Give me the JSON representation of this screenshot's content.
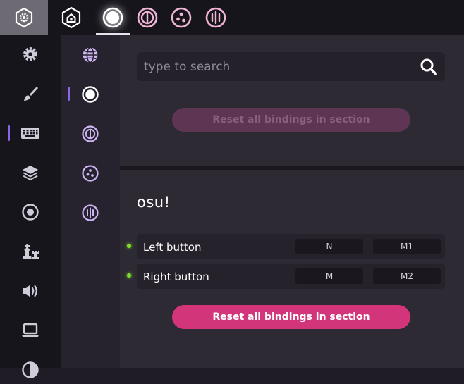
{
  "toolbar": {
    "settings_icon": "gear-hexagon-icon",
    "home_icon": "home-hexagon-icon",
    "rulesets": [
      {
        "id": "osu",
        "icon": "osu-ruleset-icon",
        "active": true
      },
      {
        "id": "taiko",
        "icon": "taiko-ruleset-icon",
        "active": false
      },
      {
        "id": "catch",
        "icon": "catch-ruleset-icon",
        "active": false
      },
      {
        "id": "mania",
        "icon": "mania-ruleset-icon",
        "active": false
      }
    ]
  },
  "sections": [
    {
      "icon": "gear-icon",
      "active": false
    },
    {
      "icon": "paintbrush-icon",
      "active": false
    },
    {
      "icon": "keyboard-icon",
      "active": true
    },
    {
      "icon": "layers-icon",
      "active": false
    },
    {
      "icon": "circle-target-icon",
      "active": false
    },
    {
      "icon": "chess-icon",
      "active": false
    },
    {
      "icon": "speaker-icon",
      "active": false
    },
    {
      "icon": "laptop-icon",
      "active": false
    },
    {
      "icon": "half-circle-icon",
      "active": false
    }
  ],
  "subsections": [
    {
      "icon": "globe-icon",
      "active": false
    },
    {
      "icon": "osu-ruleset-icon",
      "active": true
    },
    {
      "icon": "taiko-ruleset-icon",
      "active": false
    },
    {
      "icon": "catch-ruleset-icon",
      "active": false
    },
    {
      "icon": "mania-ruleset-icon",
      "active": false
    }
  ],
  "search": {
    "placeholder": "type to search",
    "value": ""
  },
  "reset_top_label": "Reset all bindings in section",
  "ruleset_section": {
    "title": "osu!",
    "bindings": [
      {
        "label": "Left button",
        "keys": [
          "N",
          "M1"
        ]
      },
      {
        "label": "Right button",
        "keys": [
          "M",
          "M2"
        ]
      }
    ],
    "reset_label": "Reset all bindings in section"
  },
  "colors": {
    "accent": "#8b67e6",
    "pink": "#d2357a",
    "pink_disabled": "#5e3552",
    "ruleset_pink": "#f0b4d4",
    "indicator_green": "#7ee02a"
  }
}
